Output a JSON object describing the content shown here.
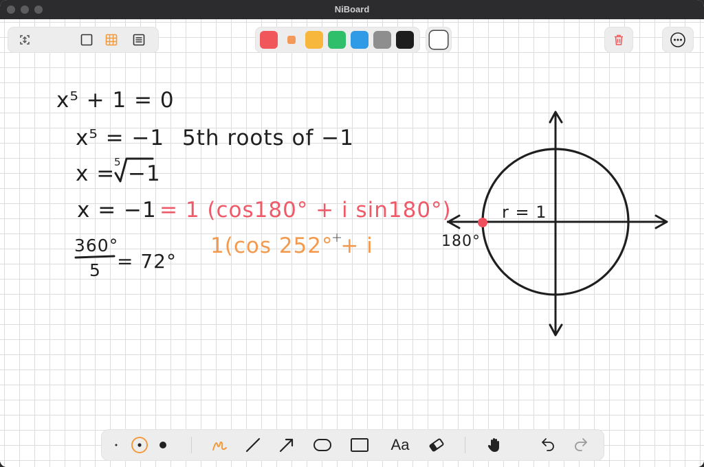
{
  "window": {
    "title": "NiBoard"
  },
  "colors": {
    "accent": "#f39a3c",
    "red": "#f0565a",
    "orange_small": "#f39a5a",
    "yellow": "#f6b73c",
    "green": "#2fbf6a",
    "blue": "#2f9be6",
    "gray": "#8e8e8e",
    "black": "#1d1d1d",
    "white": "#ffffff",
    "ink_red": "#ef5a69",
    "ink_orange": "#f39a4e",
    "ink_black": "#1f1f1f"
  },
  "toolbar_top": {
    "left_icons": [
      "expand-icon",
      "blank-page-icon",
      "grid-page-icon",
      "lined-page-icon"
    ],
    "right_icons": [
      "trash-icon",
      "more-icon"
    ]
  },
  "toolbar_bottom": {
    "text_tool_label": "Aa",
    "icons": [
      "dot-small-icon",
      "dot-medium-icon",
      "dot-large-icon",
      "pen-icon",
      "line-icon",
      "arrow-icon",
      "ellipse-icon",
      "rectangle-icon",
      "text-icon",
      "eraser-icon",
      "hand-icon",
      "undo-icon",
      "redo-icon"
    ]
  },
  "board": {
    "eq1": "x⁵ + 1 = 0",
    "eq2": "x⁵ = −1",
    "eq2_note": "5th roots of −1",
    "eq3_lhs": "x =",
    "eq3_index": "5",
    "eq3_radicand": "−1",
    "eq4": "x = −1",
    "eq4_polar": "= 1 (cos180° + i sin180°)",
    "frac_num": "360°",
    "frac_den": "5",
    "frac_result": "= 72°",
    "polar_next": "1(cos 252° + i",
    "circle_radius_label": "r = 1",
    "angle_label": "180°"
  }
}
